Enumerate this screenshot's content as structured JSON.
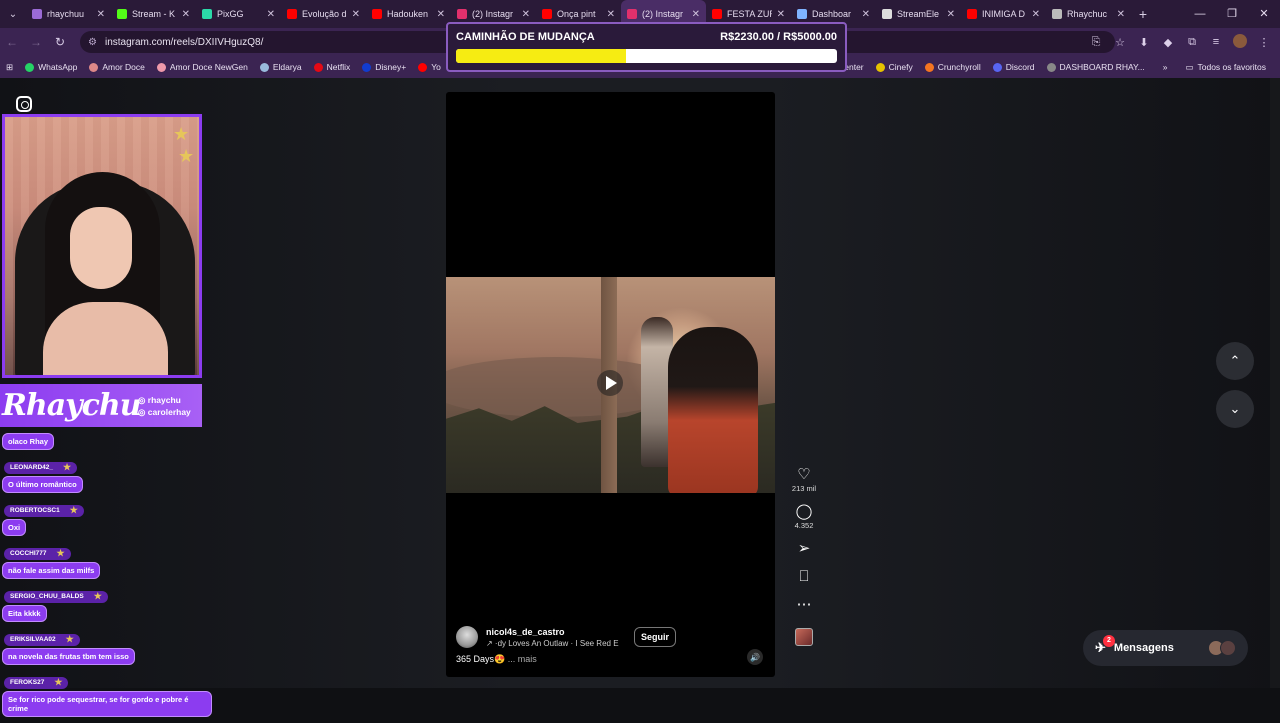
{
  "tabs": [
    {
      "label": "rhaychuu",
      "color": "#9b6bd6",
      "active": false
    },
    {
      "label": "Stream - K",
      "color": "#53fc18",
      "active": false
    },
    {
      "label": "PixGG",
      "color": "#2bd9a8",
      "active": false
    },
    {
      "label": "Evolução d",
      "color": "#ff0000",
      "active": false
    },
    {
      "label": "Hadouken",
      "color": "#ff0000",
      "active": false
    },
    {
      "label": "(2) Instagr",
      "color": "#e1306c",
      "active": false
    },
    {
      "label": "Onça pint",
      "color": "#ff0000",
      "active": false
    },
    {
      "label": "(2) Instagr",
      "color": "#e1306c",
      "active": true
    },
    {
      "label": "FESTA ZUR",
      "color": "#ff0000",
      "active": false
    },
    {
      "label": "Dashboar",
      "color": "#7fb3ff",
      "active": false
    },
    {
      "label": "StreamEle",
      "color": "#dddddd",
      "active": false
    },
    {
      "label": "INIMIGA D",
      "color": "#ff0000",
      "active": false
    },
    {
      "label": "Rhaychuc",
      "color": "#bbbbbb",
      "active": false
    }
  ],
  "address": {
    "url": "instagram.com/reels/DXIIVHguzQ8/"
  },
  "bookmarks": [
    {
      "label": "WhatsApp",
      "color": "#25d366"
    },
    {
      "label": "Amor Doce",
      "color": "#d88"
    },
    {
      "label": "Amor Doce NewGen",
      "color": "#e9a"
    },
    {
      "label": "Eldarya",
      "color": "#9bd"
    },
    {
      "label": "Netflix",
      "color": "#e50914"
    },
    {
      "label": "Disney+",
      "color": "#113ccf"
    },
    {
      "label": "Yo",
      "color": "#ff0000"
    }
  ],
  "bookmarks_right": [
    {
      "label": "Center",
      "color": "#555"
    },
    {
      "label": "Cinefy",
      "color": "#e6c200"
    },
    {
      "label": "Crunchyroll",
      "color": "#f47521"
    },
    {
      "label": "Discord",
      "color": "#5865f2"
    },
    {
      "label": "DASHBOARD RHAY...",
      "color": "#888"
    }
  ],
  "bookmarks_folder": "Todos os favoritos",
  "goal": {
    "title": "CAMINHÃO DE MUDANÇA",
    "amount": "R$2230.00 / R$5000.00",
    "progress": 0.446
  },
  "reel": {
    "author": "nicol4s_de_castro",
    "audio": "↗ ·dy Loves An Outlaw · I See Red E",
    "follow": "Seguir",
    "caption": "365 Days😍",
    "more": "... mais"
  },
  "actions": {
    "likes": "213 mil",
    "comments": "4.352"
  },
  "messages": {
    "label": "Mensagens",
    "badge": "2"
  },
  "streamer": {
    "name": "Rhaychu",
    "handle1": "rhaychu",
    "handle2": "carolerhay"
  },
  "chat": [
    {
      "user": "",
      "message": "olaco Rhay"
    },
    {
      "user": "LEONARD42_",
      "message": "O último romântico"
    },
    {
      "user": "ROBERTOCSC1",
      "message": "Oxi"
    },
    {
      "user": "COCCHI777",
      "message": "não fale assim das milfs"
    },
    {
      "user": "SERGIO_CHUU_BALDS",
      "message": "Eita kkkk"
    },
    {
      "user": "ERIKSILVAA02",
      "message": "na novela das frutas tbm tem isso"
    },
    {
      "user": "FEROKS27",
      "message": "Se for rico pode sequestrar, se for gordo e pobre é crime"
    }
  ]
}
